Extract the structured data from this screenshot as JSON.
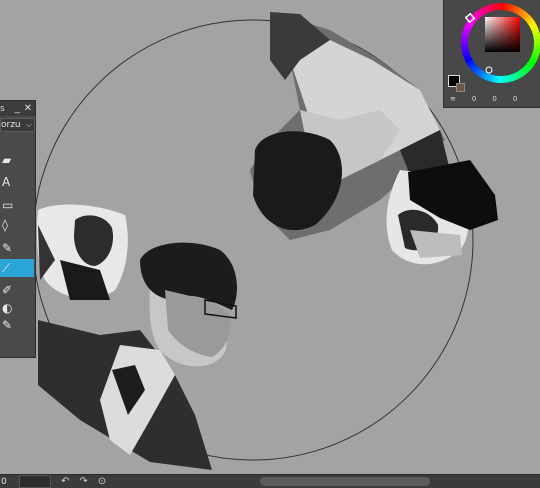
{
  "tool_panel": {
    "title_fragment": "s",
    "minimize_glyph": "_",
    "close_glyph": "✕",
    "subtool_group": "orzu",
    "tools": [
      {
        "icon": "eraser-icon",
        "glyph": "▰"
      },
      {
        "icon": "text-tool-icon",
        "glyph": "A"
      },
      {
        "icon": "frame-icon",
        "glyph": "▭"
      },
      {
        "icon": "water-drop-icon",
        "glyph": "◊"
      },
      {
        "icon": "pen-icon",
        "glyph": "✎"
      },
      {
        "icon": "brush-icon",
        "glyph": "⟋"
      },
      {
        "icon": "marker-icon",
        "glyph": "✐"
      },
      {
        "icon": "fill-icon",
        "glyph": "◐"
      },
      {
        "icon": "pencil-icon",
        "glyph": "✎"
      }
    ],
    "active_tool_index": 5
  },
  "color_panel": {
    "main_color": "#000000",
    "sub_color": "#6b5a48",
    "hue_indicator": "#ff0000",
    "slider_values": [
      "0",
      "0",
      "0"
    ]
  },
  "status_bar": {
    "zoom_fragment": "0",
    "undo_label": "↶",
    "redo_label": "↷",
    "rotate_label": "⊙"
  }
}
